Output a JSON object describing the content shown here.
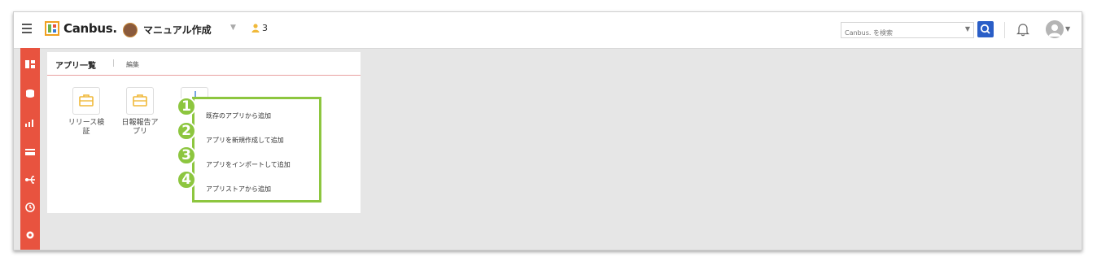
{
  "header": {
    "app_name": "Canbus.",
    "workspace_name": "マニュアル作成",
    "member_count": "3",
    "search_placeholder": "Canbus. を検索"
  },
  "panel": {
    "title": "アプリ一覧",
    "separator": "|",
    "edit_label": "編集",
    "apps": [
      {
        "label": "リリース検\n証"
      },
      {
        "label": "日報報告ア\nプリ"
      }
    ]
  },
  "add_menu": {
    "items": [
      {
        "badge": "1",
        "label": "既存のアプリから追加"
      },
      {
        "badge": "2",
        "label": "アプリを新規作成して追加"
      },
      {
        "badge": "3",
        "label": "アプリをインポートして追加"
      },
      {
        "badge": "4",
        "label": "アプリストアから追加"
      }
    ]
  },
  "colors": {
    "sidebar": "#e8533f",
    "accent_green": "#8dc63f",
    "search_button": "#2a5ec7",
    "app_icon": "#f0b93a"
  }
}
